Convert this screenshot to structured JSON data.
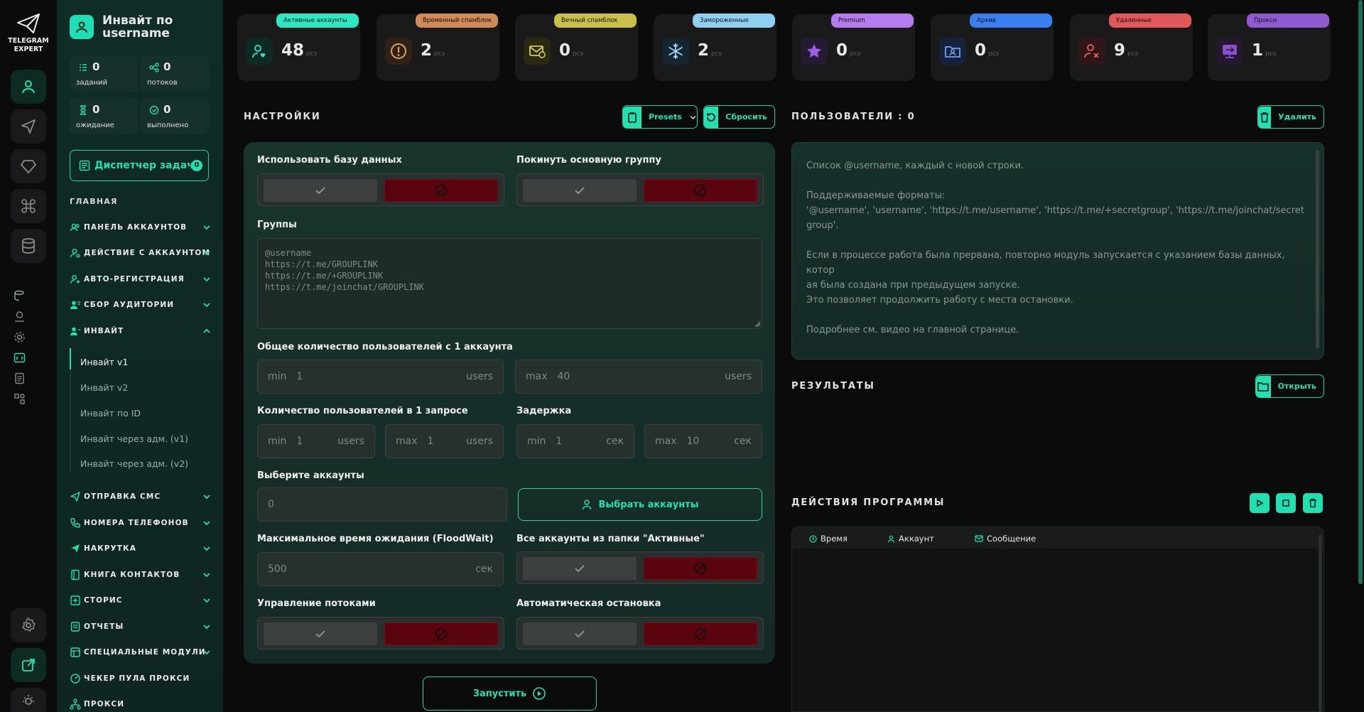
{
  "app": {
    "logo_line1": "TELEGRAM",
    "logo_line2": "EXPERT"
  },
  "header": {
    "title": "Инвайт по username"
  },
  "stats": [
    {
      "value": "0",
      "label": "заданий"
    },
    {
      "value": "0",
      "label": "потоков"
    },
    {
      "value": "0",
      "label": "ожидание"
    },
    {
      "value": "0",
      "label": "выполнено"
    }
  ],
  "dispatcher": {
    "label": "Диспетчер задач",
    "badge": "0"
  },
  "nav": {
    "section": "ГЛАВНАЯ",
    "items": [
      {
        "label": "ПАНЕЛЬ АККАУНТОВ"
      },
      {
        "label": "ДЕЙСТВИЕ С АККАУНТОМ"
      },
      {
        "label": "АВТО-РЕГИСТРАЦИЯ"
      },
      {
        "label": "СБОР АУДИТОРИИ"
      },
      {
        "label": "ИНВАЙТ"
      },
      {
        "label": "ОТПРАВКА СМС"
      },
      {
        "label": "НОМЕРА ТЕЛЕФОНОВ"
      },
      {
        "label": "НАКРУТКА"
      },
      {
        "label": "КНИГА КОНТАКТОВ"
      },
      {
        "label": "СТОРИС"
      },
      {
        "label": "ОТЧЕТЫ"
      },
      {
        "label": "СПЕЦИАЛЬНЫЕ МОДУЛИ"
      },
      {
        "label": "ЧЕКЕР ПУЛА ПРОКСИ"
      },
      {
        "label": "ПРОКСИ"
      }
    ],
    "sub": [
      {
        "label": "Инвайт v1"
      },
      {
        "label": "Инвайт v2"
      },
      {
        "label": "Инвайт по ID"
      },
      {
        "label": "Инвайт через адм. (v1)"
      },
      {
        "label": "Инвайт через адм. (v2)"
      }
    ]
  },
  "cards": [
    {
      "pill": "Активные аккаунты",
      "value": "48",
      "unit": "pcs",
      "color": "#2ee8c2"
    },
    {
      "pill": "Временный спамблок",
      "value": "2",
      "unit": "pcs",
      "color": "#d08a55"
    },
    {
      "pill": "Вечный спамблок",
      "value": "0",
      "unit": "pcs",
      "color": "#c9c04a"
    },
    {
      "pill": "Замороженные",
      "value": "2",
      "unit": "pcs",
      "color": "#8fd0f0"
    },
    {
      "pill": "Premium",
      "value": "0",
      "unit": "pcs",
      "color": "#b57cf0"
    },
    {
      "pill": "Архив",
      "value": "0",
      "unit": "pcs",
      "color": "#3a7ff0"
    },
    {
      "pill": "Удаленные",
      "value": "9",
      "unit": "pcs",
      "color": "#e0585a"
    },
    {
      "pill": "Прокси",
      "value": "1",
      "unit": "pcs",
      "color": "#8f5ad0"
    }
  ],
  "settings": {
    "title": "НАСТРОЙКИ",
    "presets": "Presets",
    "reset": "Сбросить",
    "use_db": "Использовать базу данных",
    "leave_group": "Покинуть основную группу",
    "groups": "Группы",
    "groups_placeholder": "@username\nhttps://t.me/GROUPLINK\nhttps://t.me/+GROUPLINK\nhttps://t.me/joinchat/GROUPLINK",
    "total_users": "Общее количество пользователей с 1 аккаунта",
    "total_min_k": "min",
    "total_min_v": "1",
    "total_min_u": "users",
    "total_max_k": "max",
    "total_max_v": "40",
    "total_max_u": "users",
    "per_request": "Количество пользователей в 1 запросе",
    "req_min_k": "min",
    "req_min_v": "1",
    "req_min_u": "users",
    "req_max_k": "max",
    "req_max_v": "1",
    "req_max_u": "users",
    "delay": "Задержка",
    "delay_min_k": "min",
    "delay_min_v": "1",
    "delay_min_u": "сек",
    "delay_max_k": "max",
    "delay_max_v": "10",
    "delay_max_u": "сек",
    "choose_accounts": "Выберите аккаунты",
    "accounts_value": "0",
    "choose_accounts_btn": "Выбрать аккаунты",
    "floodwait": "Максимальное время ожидания (FloodWait)",
    "floodwait_value": "500",
    "floodwait_unit": "сек",
    "all_active": "Все аккаунты из папки \"Активные\"",
    "threads": "Управление потоками",
    "auto_stop": "Автоматическая остановка",
    "run": "Запустить"
  },
  "users": {
    "title": "ПОЛЬЗОВАТЕЛИ : 0",
    "delete": "Удалить",
    "lines": [
      "Список @username, каждый с новой строки.",
      "",
      "Поддерживаемые форматы:",
      "'@username', 'username', 'https://t.me/username', 'https://t.me/+secretgroup', 'https://t.me/joinchat/secret",
      "group'.",
      "",
      "Если в процессе работа была прервана, повторно модуль запускается с указанием базы данных, котор",
      "ая была создана при предыдущем запуске.",
      "Это позволяет продолжить работу с места остановки.",
      "",
      "Подробнее см. видео на главной странице."
    ]
  },
  "results": {
    "title": "РЕЗУЛЬТАТЫ",
    "open": "Открыть"
  },
  "log": {
    "title": "ДЕЙСТВИЯ ПРОГРАММЫ",
    "col_time": "Время",
    "col_account": "Аккаунт",
    "col_message": "Сообщение"
  }
}
